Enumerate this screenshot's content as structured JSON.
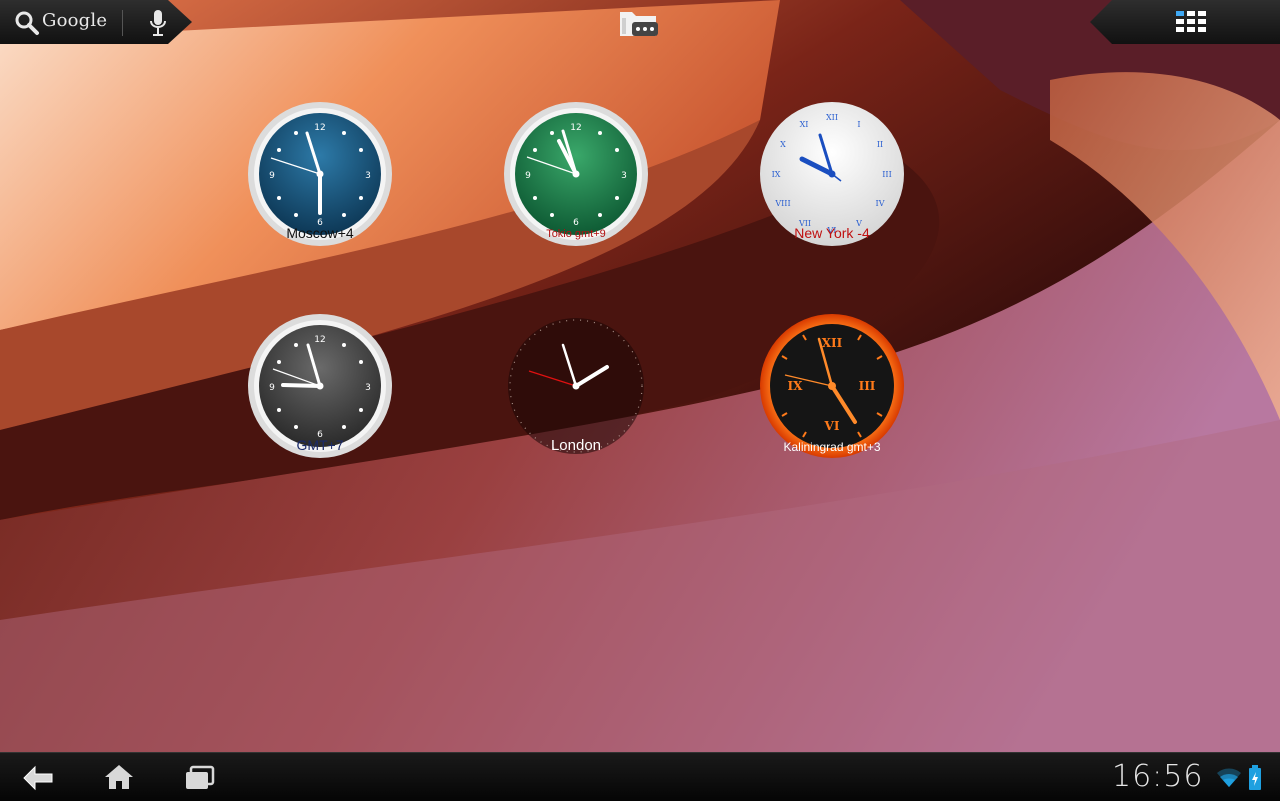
{
  "top_bar": {
    "search_label": "Google",
    "icons": [
      "search-icon",
      "microphone-icon",
      "folder-icon",
      "apps-grid-icon"
    ]
  },
  "clocks": [
    {
      "label": "Moscow+4",
      "style": "blue",
      "label_color": "#111111"
    },
    {
      "label": "Tokio gmt+9",
      "style": "green",
      "label_color": "#b01010"
    },
    {
      "label": "New York -4",
      "style": "white-roman",
      "label_color": "#c01010"
    },
    {
      "label": "GMT+7",
      "style": "grey",
      "label_color": "#1a2a6a"
    },
    {
      "label": "London",
      "style": "minimal-dark",
      "label_color": "#ffffff"
    },
    {
      "label": "Kaliningrad gmt+3",
      "style": "orange-roman",
      "label_color": "#ffffff"
    }
  ],
  "nav_bar": {
    "icons": [
      "back-icon",
      "home-icon",
      "recent-apps-icon",
      "wifi-icon",
      "battery-charging-icon"
    ]
  },
  "status": {
    "time": "16:56"
  }
}
